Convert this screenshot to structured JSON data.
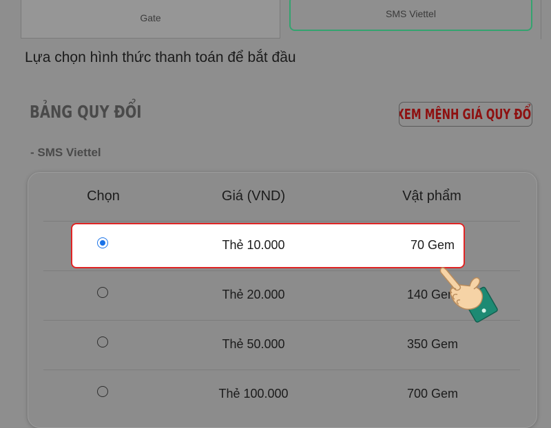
{
  "tabs": [
    {
      "label": "Gate",
      "selected": false
    },
    {
      "label": "SMS Viettel",
      "selected": true
    }
  ],
  "prompt": "Lựa chọn hình thức thanh toán để bắt đầu",
  "section": {
    "title": "BẢNG QUY ĐỔI",
    "rate_button_label": "XEM MỆNH GIÁ QUY ĐỔI",
    "provider_label": "- SMS Viettel"
  },
  "table": {
    "headers": [
      "Chọn",
      "Giá (VND)",
      "Vật phẩm"
    ],
    "rows": [
      {
        "price": "Thẻ 10.000",
        "item": "70 Gem",
        "selected": true
      },
      {
        "price": "Thẻ 20.000",
        "item": "140 Gem",
        "selected": false
      },
      {
        "price": "Thẻ 50.000",
        "item": "350 Gem",
        "selected": false
      },
      {
        "price": "Thẻ 100.000",
        "item": "700 Gem",
        "selected": false
      }
    ]
  },
  "colors": {
    "accent_green": "#33a36f",
    "highlight_red": "#e02424",
    "button_text_red": "#8e1010",
    "radio_blue": "#1a73e8",
    "hand_cuff_teal": "#1d8a73",
    "hand_skin": "#f6d3a6"
  },
  "icons": {
    "pointer": "pointing-hand-icon"
  }
}
